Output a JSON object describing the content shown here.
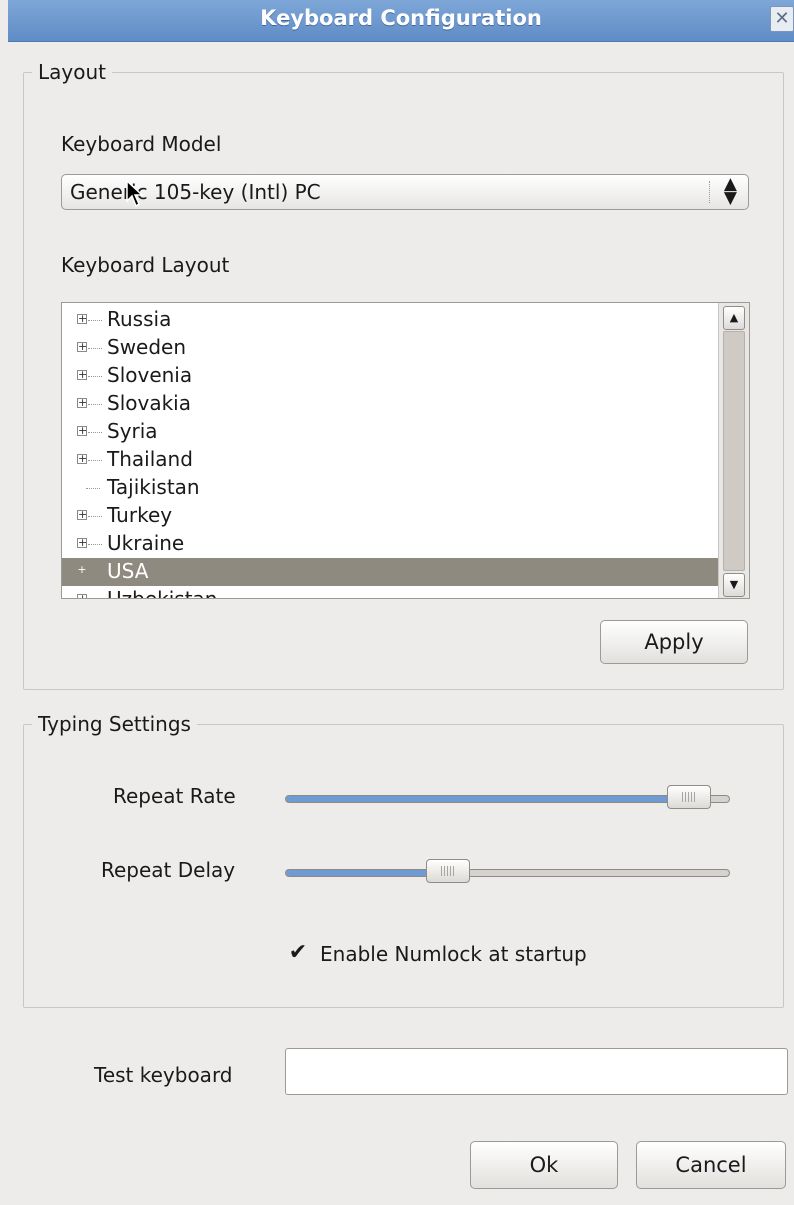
{
  "window": {
    "title": "Keyboard Configuration",
    "close_icon": "close-icon"
  },
  "layout_section": {
    "legend": "Layout",
    "keyboard_model_label": "Keyboard Model",
    "keyboard_model_value": "Generic 105-key (Intl) PC",
    "keyboard_layout_label": "Keyboard Layout",
    "layouts": [
      {
        "label": "Russia",
        "expandable": true
      },
      {
        "label": "Sweden",
        "expandable": true
      },
      {
        "label": "Slovenia",
        "expandable": true
      },
      {
        "label": "Slovakia",
        "expandable": true
      },
      {
        "label": "Syria",
        "expandable": true
      },
      {
        "label": "Thailand",
        "expandable": true
      },
      {
        "label": "Tajikistan",
        "expandable": false
      },
      {
        "label": "Turkey",
        "expandable": true
      },
      {
        "label": "Ukraine",
        "expandable": true
      },
      {
        "label": "USA",
        "expandable": true,
        "selected": true
      },
      {
        "label": "Uzbekistan",
        "expandable": true
      }
    ],
    "apply_label": "Apply"
  },
  "typing_section": {
    "legend": "Typing Settings",
    "repeat_rate_label": "Repeat Rate",
    "repeat_rate_fraction": 0.95,
    "repeat_delay_label": "Repeat Delay",
    "repeat_delay_fraction": 0.35,
    "numlock_label": "Enable Numlock at startup",
    "numlock_checked": true
  },
  "test": {
    "label": "Test keyboard",
    "value": ""
  },
  "buttons": {
    "ok": "Ok",
    "cancel": "Cancel"
  },
  "colors": {
    "titlebar": "#6b96cd",
    "selection": "#8f8a80",
    "slider_fill": "#6f9bd2"
  }
}
